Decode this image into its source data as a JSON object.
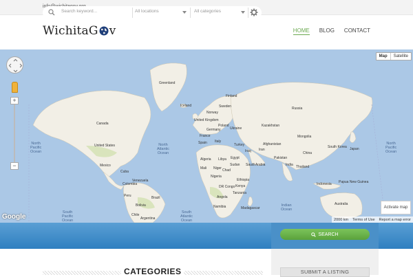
{
  "topbar": {
    "email": "info@wichitagov.org"
  },
  "header": {
    "logo_prefix": "WichitaG",
    "logo_suffix": "v",
    "nav": [
      {
        "label": "HOME",
        "active": true
      },
      {
        "label": "BLOG",
        "active": false
      },
      {
        "label": "CONTACT",
        "active": false
      }
    ]
  },
  "map": {
    "type_map": "Map",
    "type_satellite": "Satellite",
    "activate": "Activate map",
    "google": "Google",
    "scale": "2000 km",
    "terms": "Terms of Use",
    "report": "Report a map error",
    "places": [
      "Greenland",
      "Iceland",
      "Finland",
      "Norway",
      "Sweden",
      "United Kingdom",
      "Poland",
      "Germany",
      "France",
      "Spain",
      "Italy",
      "Ukraine",
      "Turkey",
      "Russia",
      "Kazakhstan",
      "Mongolia",
      "China",
      "Japan",
      "South Korea",
      "Iran",
      "Afghanistan",
      "Pakistan",
      "India",
      "Thailand",
      "Iraq",
      "Saudi Arabia",
      "Egypt",
      "Libya",
      "Algeria",
      "Mali",
      "Niger",
      "Chad",
      "Sudan",
      "Nigeria",
      "Ethiopia",
      "DR Congo",
      "Kenya",
      "Tanzania",
      "Angola",
      "Namibia",
      "Madagascar",
      "Canada",
      "United States",
      "Mexico",
      "Cuba",
      "Venezuela",
      "Colombia",
      "Peru",
      "Brazil",
      "Bolivia",
      "Chile",
      "Argentina",
      "Indonesia",
      "Papua New Guinea",
      "Australia"
    ],
    "oceans": [
      "North\nPacific\nOcean",
      "North\nAtlantic\nOcean",
      "North\nPacific\nOcean",
      "South\nPacific\nOcean",
      "South\nAtlantic\nOcean",
      "Indian\nOcean"
    ]
  },
  "search": {
    "keyword_placeholder": "Search keyword...",
    "locations": "All locations",
    "categories": "All categories",
    "button": "SEARCH"
  },
  "bottom": {
    "categories_title": "CATEGORIES",
    "submit": "SUBMIT A LISTING"
  },
  "colors": {
    "accent_green": "#6aa84f",
    "search_blue": "#2f7fc0",
    "ocean": "#abc8e6",
    "land": "#f2efe6"
  }
}
